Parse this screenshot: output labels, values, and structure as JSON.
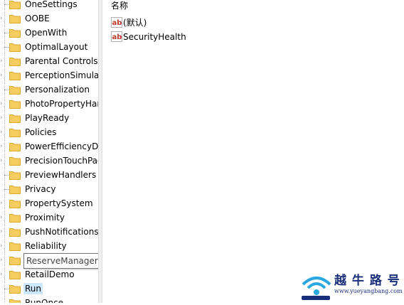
{
  "tree": {
    "items": [
      {
        "label": "OneSettings",
        "expandable": false
      },
      {
        "label": "OOBE",
        "expandable": true
      },
      {
        "label": "OpenWith",
        "expandable": false
      },
      {
        "label": "OptimalLayout",
        "expandable": false
      },
      {
        "label": "Parental Controls",
        "expandable": true
      },
      {
        "label": "PerceptionSimulationExtensions",
        "expandable": true
      },
      {
        "label": "Personalization",
        "expandable": false
      },
      {
        "label": "PhotoPropertyHandler",
        "expandable": true
      },
      {
        "label": "PlayReady",
        "expandable": true
      },
      {
        "label": "Policies",
        "expandable": true
      },
      {
        "label": "PowerEfficiencyDiagnostics",
        "expandable": true
      },
      {
        "label": "PrecisionTouchPad",
        "expandable": true
      },
      {
        "label": "PreviewHandlers",
        "expandable": false
      },
      {
        "label": "Privacy",
        "expandable": false
      },
      {
        "label": "PropertySystem",
        "expandable": true
      },
      {
        "label": "Proximity",
        "expandable": true
      },
      {
        "label": "PushNotifications",
        "expandable": true
      },
      {
        "label": "Reliability",
        "expandable": true
      },
      {
        "label": "ReserveManager",
        "expandable": true
      },
      {
        "label": "RetailDemo",
        "expandable": true
      },
      {
        "label": "Run",
        "expandable": false
      },
      {
        "label": "RunOnce",
        "expandable": false
      }
    ],
    "selected": "Run",
    "tooltip_item": "ReserveManager"
  },
  "values_pane": {
    "column_name": "名称",
    "rows": [
      {
        "name": "(默认)",
        "icon": "ab-string-icon"
      },
      {
        "name": "SecurityHealth",
        "icon": "ab-string-icon"
      }
    ]
  },
  "watermark": {
    "title": "越 牛 路 号 网",
    "url": "www.yueyangbang.com"
  },
  "colors": {
    "folder": "#f5cd61",
    "selection": "#cce8ff",
    "ab_icon_red": "#c0392b",
    "watermark_blue": "#1a2f7a"
  }
}
